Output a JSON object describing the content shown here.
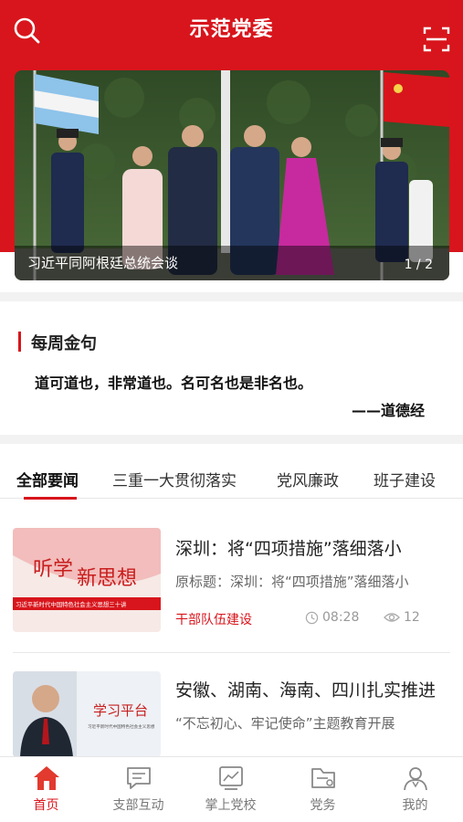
{
  "header": {
    "title": "示范党委",
    "search_icon": "search-icon",
    "scan_icon": "scan-icon",
    "accent_color": "#d8151c"
  },
  "banner": {
    "caption": "习近平同阿根廷总统会谈",
    "pager": "1 / 2"
  },
  "quote": {
    "title": "每周金句",
    "text": "道可道也，非常道也。名可名也是非名也。",
    "source": "——道德经"
  },
  "tabs": [
    {
      "label": "全部要闻",
      "active": true
    },
    {
      "label": "三重一大贯彻落实"
    },
    {
      "label": "党风廉政"
    },
    {
      "label": "班子建设"
    }
  ],
  "news": [
    {
      "title": "深圳：将“四项措施”落细落小",
      "subtitle": "原标题：深圳：将“四项措施”落细落小",
      "tag": "干部队伍建设",
      "time": "08:28",
      "views": "12",
      "thumb_text": {
        "line1": "听学",
        "line2": "新思想",
        "caption": "习近平新时代中国特色社会主义思想三十讲"
      }
    },
    {
      "title": "安徽、湖南、海南、四川扎实推进",
      "subtitle": "“不忘初心、牢记使命”主题教育开展",
      "thumb_text": {
        "line1": "学习平台",
        "caption": "习近平新时代中国特色社会主义思想"
      }
    }
  ],
  "bottom_nav": [
    {
      "label": "首页",
      "icon": "home-icon",
      "active": true
    },
    {
      "label": "支部互动",
      "icon": "chat-icon"
    },
    {
      "label": "掌上党校",
      "icon": "school-icon"
    },
    {
      "label": "党务",
      "icon": "folder-icon"
    },
    {
      "label": "我的",
      "icon": "user-icon"
    }
  ]
}
